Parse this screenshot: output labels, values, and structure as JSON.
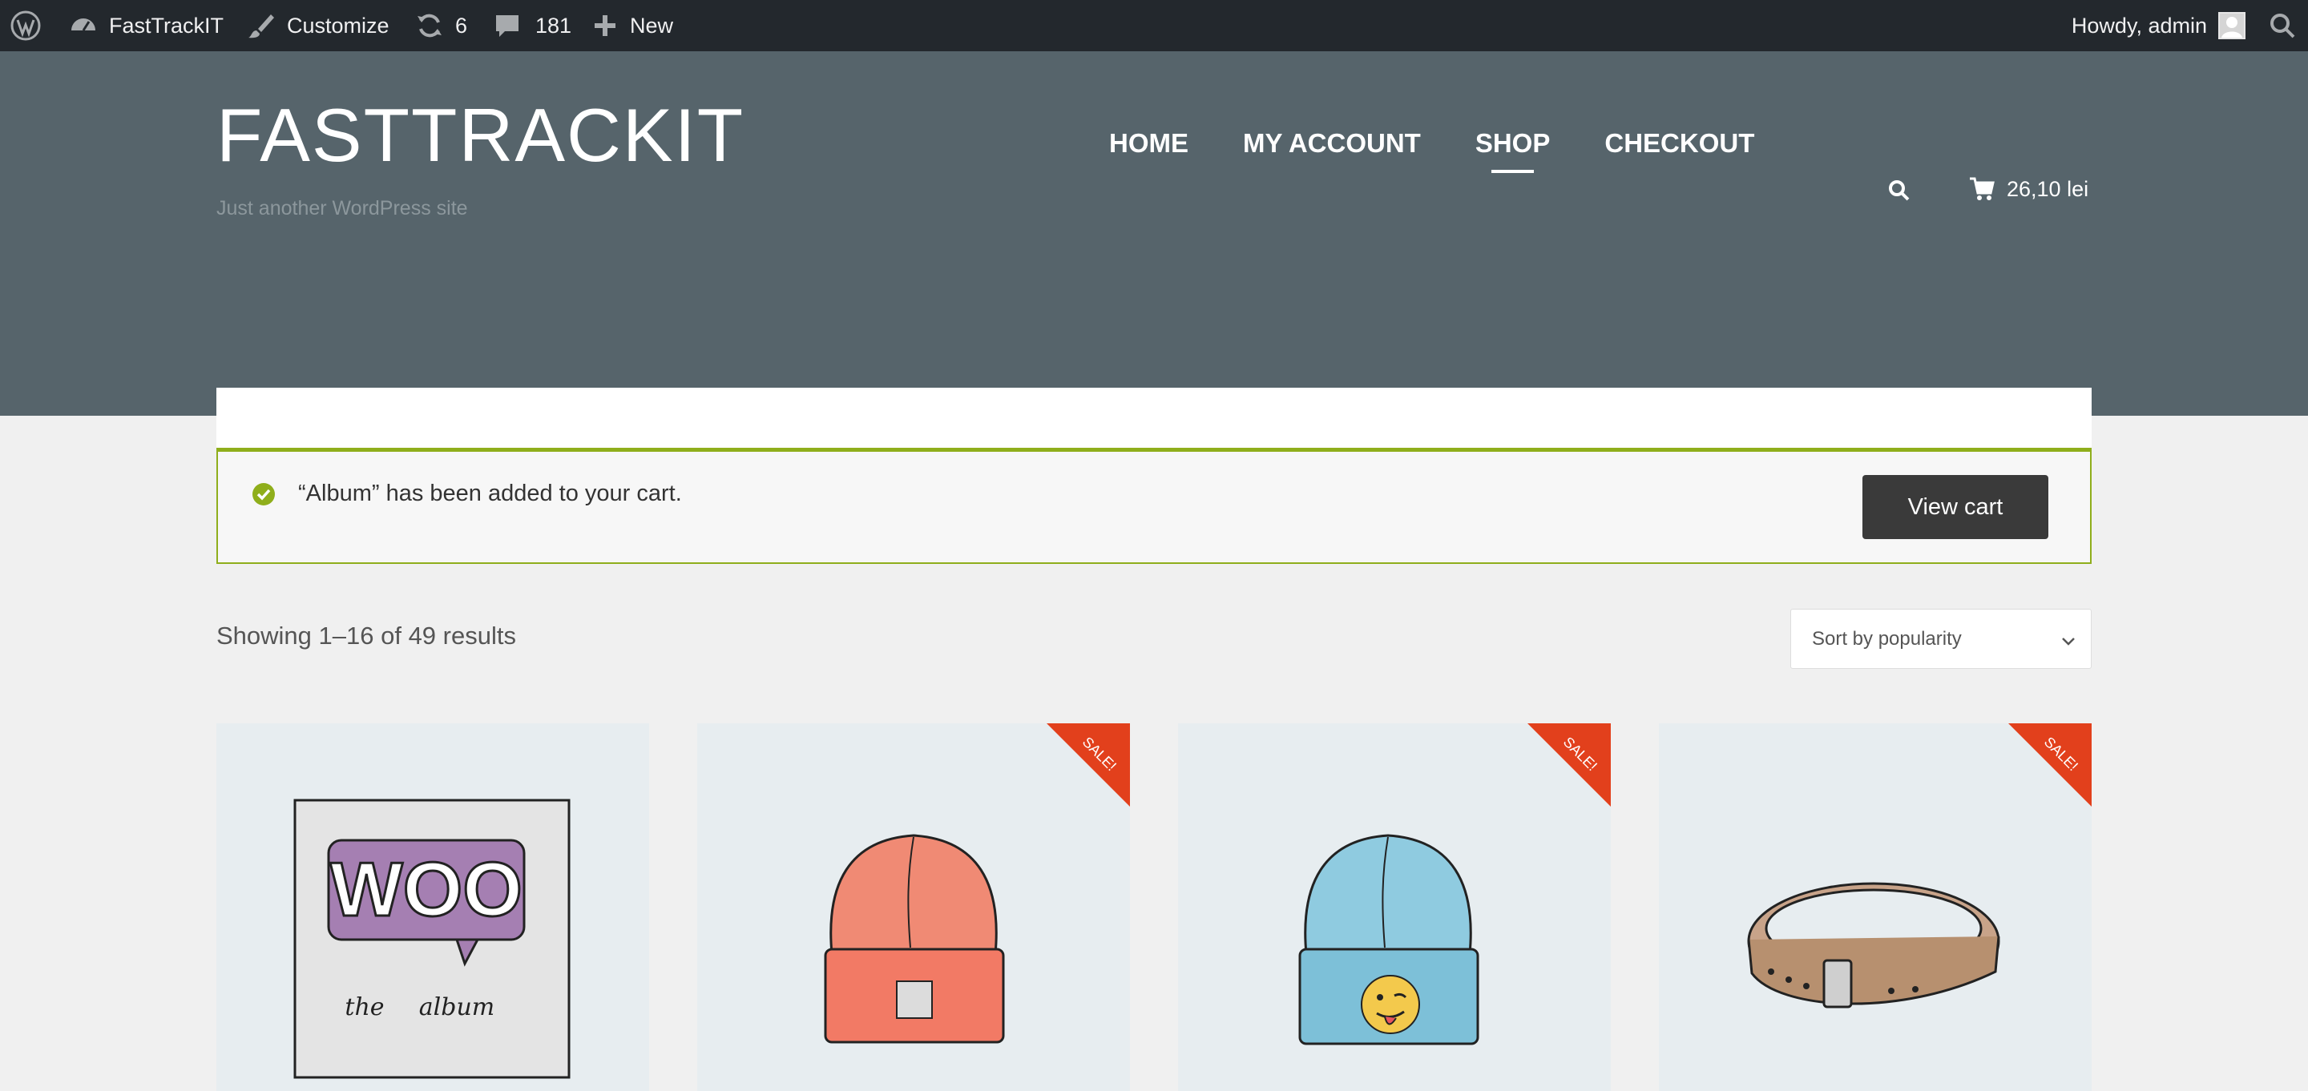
{
  "adminbar": {
    "site_name": "FastTrackIT",
    "customize": "Customize",
    "updates_count": "6",
    "comments_count": "181",
    "new_label": "New",
    "howdy": "Howdy, admin"
  },
  "header": {
    "site_title": "FASTTRACKIT",
    "tagline": "Just another WordPress site",
    "nav": [
      "HOME",
      "MY ACCOUNT",
      "SHOP",
      "CHECKOUT"
    ],
    "active_nav": "SHOP",
    "cart_total": "26,10 lei"
  },
  "notice": {
    "message": "“Album” has been added to your cart.",
    "button": "View cart"
  },
  "results": {
    "count_text": "Showing 1–16 of 49 results",
    "sort_selected": "Sort by popularity"
  },
  "products": [
    {
      "image": "woo-album",
      "art_text_1": "WOO",
      "art_text_2": "the",
      "art_text_3": "album",
      "sale": false
    },
    {
      "image": "orange-beanie",
      "sale": true,
      "badge": "SALE!"
    },
    {
      "image": "blue-beanie-with-emoji",
      "sale": true,
      "badge": "SALE!"
    },
    {
      "image": "leather-belt",
      "sale": true,
      "badge": "SALE!"
    }
  ],
  "colors": {
    "adminbar_bg": "#23282d",
    "header_bg": "#56646b",
    "success_accent": "#8fae1b",
    "sale_badge": "#e2401c",
    "button_dark": "#3a3a3a"
  }
}
